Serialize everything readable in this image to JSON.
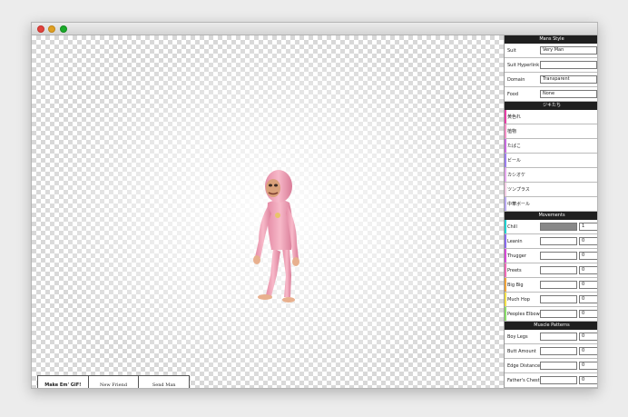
{
  "controls": {
    "make_gif": "Make Em' GIF!",
    "new_friend": "New Friend",
    "send_man": "Send Man"
  },
  "panel": {
    "mans_style": {
      "title": "Mans Style",
      "rows": [
        {
          "label": "Suit",
          "value": "Very Man"
        },
        {
          "label": "Suit Hyperlink",
          "value": ""
        },
        {
          "label": "Domain",
          "value": "Transparent"
        },
        {
          "label": "Food",
          "value": "None"
        }
      ]
    },
    "jokes": {
      "title": "ジキたち",
      "items": [
        {
          "label": "黄色れ",
          "color": "#e83fa8"
        },
        {
          "label": "植物",
          "color": "#f48fc6"
        },
        {
          "label": "たばこ",
          "color": "#c86be0"
        },
        {
          "label": "ビール",
          "color": "#9c7ef0"
        },
        {
          "label": "カシオケ",
          "color": "#e4a6ee"
        },
        {
          "label": "ツンプラス",
          "color": "#f2cce4"
        },
        {
          "label": "中華ボール",
          "color": "#b9a8f2"
        }
      ]
    },
    "movements": {
      "title": "Movements",
      "rows": [
        {
          "label": "Chill",
          "value": "1",
          "level": 1,
          "color": "#1fd2d2"
        },
        {
          "label": "Leanin",
          "value": "0",
          "level": 0,
          "color": "#8a6cf0"
        },
        {
          "label": "Thugger",
          "value": "0",
          "level": 0,
          "color": "#d84ad8"
        },
        {
          "label": "Preets",
          "value": "0",
          "level": 0,
          "color": "#f06ab8"
        },
        {
          "label": "Big Big",
          "value": "0",
          "level": 0,
          "color": "#f2a43a"
        },
        {
          "label": "Much Hop",
          "value": "0",
          "level": 0,
          "color": "#f4e24a"
        },
        {
          "label": "Peoples Elbow",
          "value": "0",
          "level": 0,
          "color": "#8be06a"
        }
      ]
    },
    "muscle_patterns": {
      "title": "Muscle Patterns",
      "rows": [
        {
          "label": "Boy Legs",
          "value": "0",
          "level": 0
        },
        {
          "label": "Butt Amount",
          "value": "0",
          "level": 0
        },
        {
          "label": "Edge Distance",
          "value": "0",
          "level": 0
        },
        {
          "label": "Father's Chest",
          "value": "0",
          "level": 0
        }
      ]
    }
  }
}
